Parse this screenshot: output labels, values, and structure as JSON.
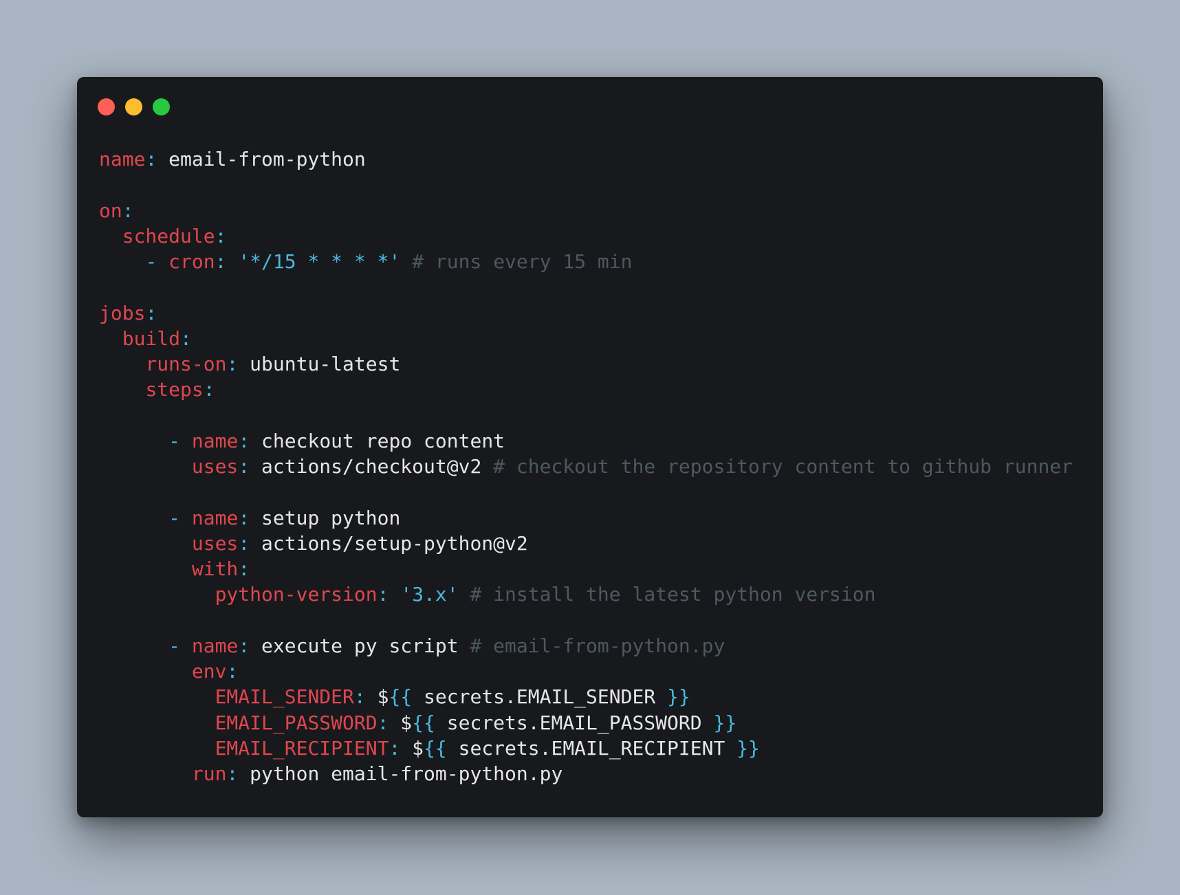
{
  "window": {
    "controls": [
      "close",
      "minimize",
      "maximize"
    ]
  },
  "code": {
    "language": "yaml",
    "lines": [
      {
        "parts": [
          [
            "k",
            "name"
          ],
          [
            "p",
            ":"
          ],
          [
            "v",
            " email-from-python"
          ]
        ]
      },
      {
        "parts": []
      },
      {
        "parts": [
          [
            "k",
            "on"
          ],
          [
            "p",
            ":"
          ]
        ]
      },
      {
        "parts": [
          [
            "v",
            "  "
          ],
          [
            "k",
            "schedule"
          ],
          [
            "p",
            ":"
          ]
        ]
      },
      {
        "parts": [
          [
            "v",
            "    "
          ],
          [
            "p",
            "- "
          ],
          [
            "k",
            "cron"
          ],
          [
            "p",
            ":"
          ],
          [
            "v",
            " "
          ],
          [
            "s",
            "'*/15 * * * *'"
          ],
          [
            "v",
            " "
          ],
          [
            "c",
            "# runs every 15 min"
          ]
        ]
      },
      {
        "parts": []
      },
      {
        "parts": [
          [
            "k",
            "jobs"
          ],
          [
            "p",
            ":"
          ]
        ]
      },
      {
        "parts": [
          [
            "v",
            "  "
          ],
          [
            "k",
            "build"
          ],
          [
            "p",
            ":"
          ]
        ]
      },
      {
        "parts": [
          [
            "v",
            "    "
          ],
          [
            "k",
            "runs-on"
          ],
          [
            "p",
            ":"
          ],
          [
            "v",
            " ubuntu-latest"
          ]
        ]
      },
      {
        "parts": [
          [
            "v",
            "    "
          ],
          [
            "k",
            "steps"
          ],
          [
            "p",
            ":"
          ]
        ]
      },
      {
        "parts": []
      },
      {
        "parts": [
          [
            "v",
            "      "
          ],
          [
            "p",
            "- "
          ],
          [
            "k",
            "name"
          ],
          [
            "p",
            ":"
          ],
          [
            "v",
            " checkout repo content"
          ]
        ]
      },
      {
        "parts": [
          [
            "v",
            "        "
          ],
          [
            "k",
            "uses"
          ],
          [
            "p",
            ":"
          ],
          [
            "v",
            " actions/checkout@v2 "
          ],
          [
            "c",
            "# checkout the repository content to github runner"
          ]
        ]
      },
      {
        "parts": []
      },
      {
        "parts": [
          [
            "v",
            "      "
          ],
          [
            "p",
            "- "
          ],
          [
            "k",
            "name"
          ],
          [
            "p",
            ":"
          ],
          [
            "v",
            " setup python"
          ]
        ]
      },
      {
        "parts": [
          [
            "v",
            "        "
          ],
          [
            "k",
            "uses"
          ],
          [
            "p",
            ":"
          ],
          [
            "v",
            " actions/setup-python@v2"
          ]
        ]
      },
      {
        "parts": [
          [
            "v",
            "        "
          ],
          [
            "k",
            "with"
          ],
          [
            "p",
            ":"
          ]
        ]
      },
      {
        "parts": [
          [
            "v",
            "          "
          ],
          [
            "k",
            "python-version"
          ],
          [
            "p",
            ":"
          ],
          [
            "v",
            " "
          ],
          [
            "s",
            "'3.x'"
          ],
          [
            "v",
            " "
          ],
          [
            "c",
            "# install the latest python version"
          ]
        ]
      },
      {
        "parts": []
      },
      {
        "parts": [
          [
            "v",
            "      "
          ],
          [
            "p",
            "- "
          ],
          [
            "k",
            "name"
          ],
          [
            "p",
            ":"
          ],
          [
            "v",
            " execute py script "
          ],
          [
            "c",
            "# email-from-python.py"
          ]
        ]
      },
      {
        "parts": [
          [
            "v",
            "        "
          ],
          [
            "k",
            "env"
          ],
          [
            "p",
            ":"
          ]
        ]
      },
      {
        "parts": [
          [
            "v",
            "          "
          ],
          [
            "k",
            "EMAIL_SENDER"
          ],
          [
            "p",
            ":"
          ],
          [
            "v",
            " $"
          ],
          [
            "p",
            "{{"
          ],
          [
            "v",
            " secrets.EMAIL_SENDER "
          ],
          [
            "p",
            "}}"
          ]
        ]
      },
      {
        "parts": [
          [
            "v",
            "          "
          ],
          [
            "k",
            "EMAIL_PASSWORD"
          ],
          [
            "p",
            ":"
          ],
          [
            "v",
            " $"
          ],
          [
            "p",
            "{{"
          ],
          [
            "v",
            " secrets.EMAIL_PASSWORD "
          ],
          [
            "p",
            "}}"
          ]
        ]
      },
      {
        "parts": [
          [
            "v",
            "          "
          ],
          [
            "k",
            "EMAIL_RECIPIENT"
          ],
          [
            "p",
            ":"
          ],
          [
            "v",
            " $"
          ],
          [
            "p",
            "{{"
          ],
          [
            "v",
            " secrets.EMAIL_RECIPIENT "
          ],
          [
            "p",
            "}}"
          ]
        ]
      },
      {
        "parts": [
          [
            "v",
            "        "
          ],
          [
            "k",
            "run"
          ],
          [
            "p",
            ":"
          ],
          [
            "v",
            " python email-from-python.py"
          ]
        ]
      }
    ]
  },
  "colors": {
    "background": "#a9b5c2",
    "window": "#17191c",
    "key": "#e0464f",
    "punctuation": "#4cb8e0",
    "string": "#4cb8e0",
    "comment": "#4d5861",
    "text": "#e6e6e6",
    "close": "#ff5f57",
    "minimize": "#febc2e",
    "maximize": "#28c840"
  }
}
